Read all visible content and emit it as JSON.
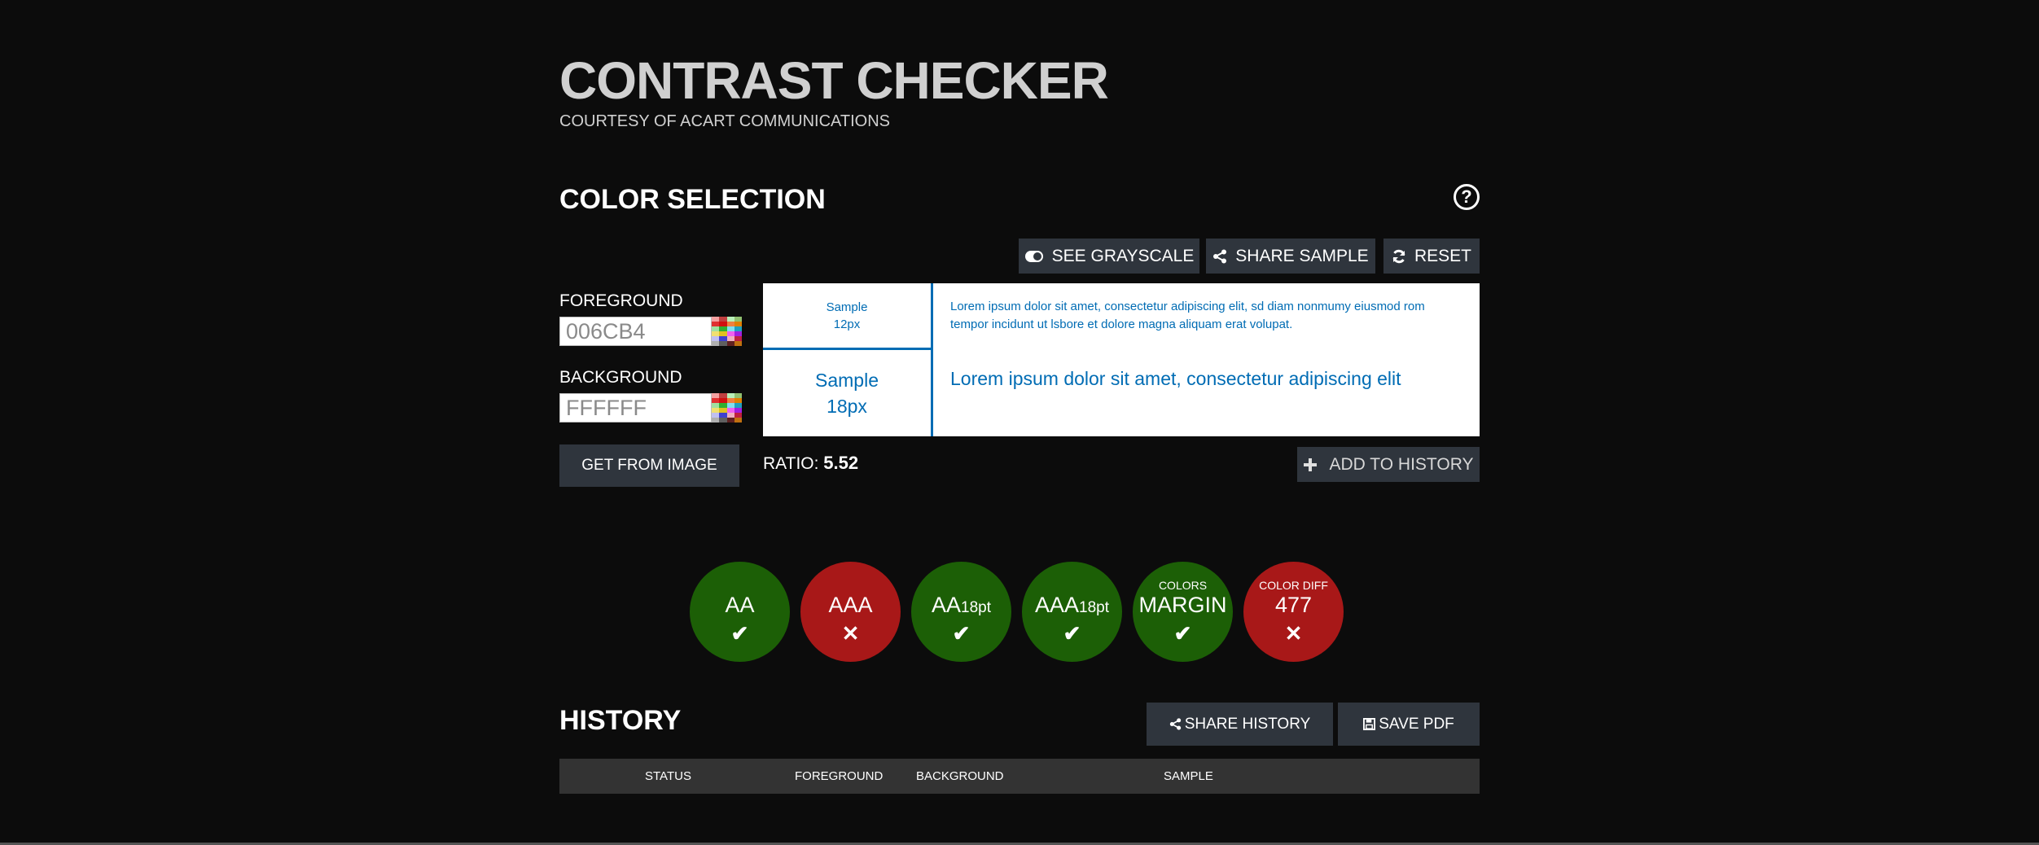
{
  "header": {
    "title": "CONTRAST CHECKER",
    "subtitle": "COURTESY OF ACART COMMUNICATIONS"
  },
  "color_selection": {
    "heading": "COLOR SELECTION",
    "help_icon": "question-circle-icon",
    "help_glyph": "?",
    "toolbar": {
      "grayscale_label": "SEE GRAYSCALE",
      "grayscale_icon": "toggle-icon",
      "share_sample_label": "SHARE SAMPLE",
      "share_icon": "share-icon",
      "reset_label": "RESET",
      "reset_icon": "refresh-icon"
    },
    "foreground": {
      "label": "FOREGROUND",
      "value": "006CB4",
      "picker_icon": "color-palette-icon"
    },
    "background": {
      "label": "BACKGROUND",
      "value": "FFFFFF",
      "picker_icon": "color-palette-icon"
    },
    "get_from_image_label": "GET FROM IMAGE",
    "colors": {
      "foreground_hex": "#006CB4",
      "background_hex": "#FFFFFF",
      "pass": "#1c5f06",
      "fail": "#a81818"
    }
  },
  "samples": {
    "small_label_line1": "Sample",
    "small_label_line2": "12px",
    "large_label_line1": "Sample",
    "large_label_line2": "18px",
    "small_text": "Lorem ipsum dolor sit amet, consectetur adipiscing elit, sd diam nonmumy eiusmod rom tempor incidunt ut lsbore et dolore magna aliquam erat volupat.",
    "large_text": "Lorem ipsum dolor sit amet, consectetur adipiscing elit"
  },
  "ratio": {
    "label": "RATIO:",
    "value": "5.52"
  },
  "add_to_history": {
    "label": "ADD TO HISTORY",
    "icon": "plus-icon"
  },
  "results": [
    {
      "top": "",
      "main": "AA",
      "suffix": "",
      "status": "pass",
      "mark": "✔"
    },
    {
      "top": "",
      "main": "AAA",
      "suffix": "",
      "status": "fail",
      "mark": "✕"
    },
    {
      "top": "",
      "main": "AA",
      "suffix": "18pt",
      "status": "pass",
      "mark": "✔"
    },
    {
      "top": "",
      "main": "AAA",
      "suffix": "18pt",
      "status": "pass",
      "mark": "✔"
    },
    {
      "top": "COLORS",
      "main": "MARGIN",
      "suffix": "",
      "status": "pass",
      "mark": "✔"
    },
    {
      "top": "COLOR DIFF",
      "main": "477",
      "suffix": "",
      "status": "fail",
      "mark": "✕"
    }
  ],
  "history": {
    "heading": "HISTORY",
    "share_label": "SHARE HISTORY",
    "share_icon": "share-icon",
    "save_pdf_label": "SAVE PDF",
    "save_icon": "floppy-disk-icon",
    "columns": [
      "STATUS",
      "FOREGROUND",
      "BACKGROUND",
      "SAMPLE"
    ],
    "rows": []
  }
}
